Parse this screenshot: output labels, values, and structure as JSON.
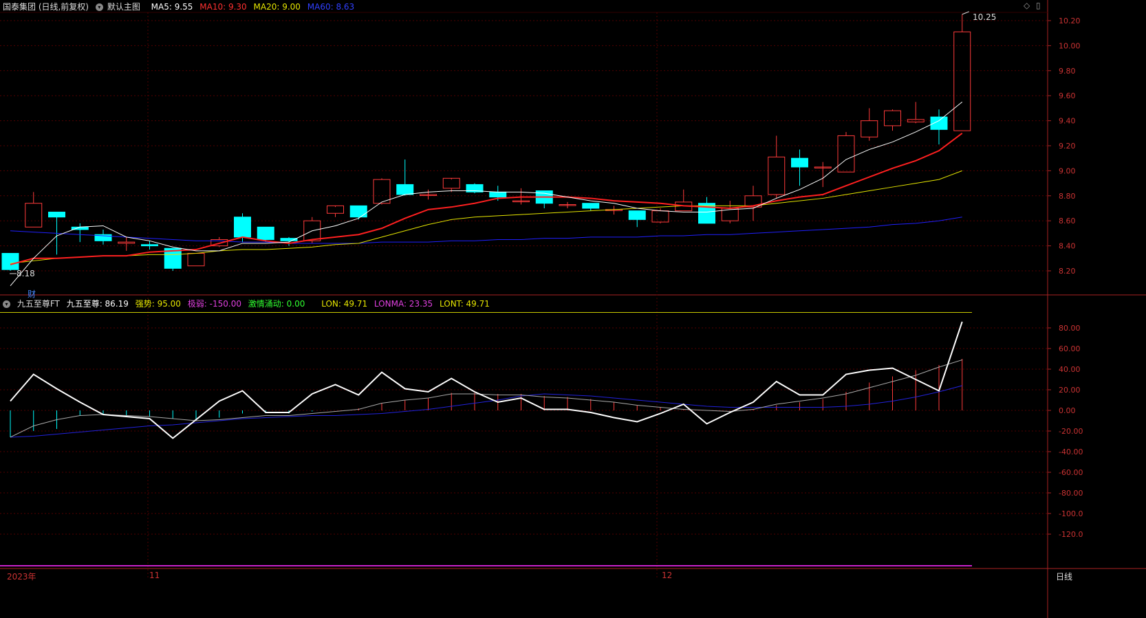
{
  "header": {
    "stock_name": "国泰集团 (日线,前复权)",
    "template_name": "默认主图",
    "ma5": "MA5: 9.55",
    "ma10": "MA10: 9.30",
    "ma20": "MA20: 9.00",
    "ma60": "MA60: 8.63"
  },
  "indicator_header": {
    "name": "九五至尊FT",
    "main": "九五至尊: 86.19",
    "strong": "强势: 95.00",
    "weak": "极弱: -150.00",
    "passion": "激情涌动: 0.00",
    "lon": "LON: 49.71",
    "lonma": "LONMA: 23.35",
    "lont": "LONT: 49.71"
  },
  "bottom": {
    "year_label": "2023年",
    "month_11": "11",
    "month_12": "12",
    "period_label": "日线"
  },
  "annotations": {
    "max_label": "10.25",
    "min_label": "8.18",
    "finance_marker": "财"
  },
  "colors": {
    "up": "#ff3b3b",
    "down": "#00ffff",
    "ma5": "#ffffff",
    "ma10": "#ff2020",
    "ma20": "#e6e600",
    "ma60": "#2020ff",
    "grid": "#550000",
    "lonma": "#aaaaaa",
    "lont": "#2222dd",
    "strong_line": "#cccc00",
    "weak_line": "#cc22cc"
  },
  "chart_data": [
    {
      "type": "candlestick",
      "ylim": [
        8.1,
        10.3
      ],
      "yticks": [
        "10.20",
        "10.00",
        "9.80",
        "9.60",
        "9.40",
        "9.20",
        "9.00",
        "8.80",
        "8.60",
        "8.40",
        "8.20"
      ],
      "ohlc": [
        [
          8.34,
          8.34,
          8.2,
          8.21
        ],
        [
          8.55,
          8.83,
          8.55,
          8.74
        ],
        [
          8.67,
          8.67,
          8.33,
          8.63
        ],
        [
          8.55,
          8.58,
          8.43,
          8.53
        ],
        [
          8.49,
          8.53,
          8.41,
          8.44
        ],
        [
          8.42,
          8.47,
          8.36,
          8.43
        ],
        [
          8.41,
          8.44,
          8.37,
          8.4
        ],
        [
          8.38,
          8.38,
          8.2,
          8.22
        ],
        [
          8.24,
          8.34,
          8.24,
          8.34
        ],
        [
          8.4,
          8.47,
          8.39,
          8.45
        ],
        [
          8.63,
          8.66,
          8.43,
          8.47
        ],
        [
          8.55,
          8.55,
          8.43,
          8.45
        ],
        [
          8.46,
          8.47,
          8.4,
          8.44
        ],
        [
          8.44,
          8.63,
          8.42,
          8.6
        ],
        [
          8.66,
          8.71,
          8.63,
          8.72
        ],
        [
          8.72,
          8.72,
          8.61,
          8.63
        ],
        [
          8.74,
          8.94,
          8.73,
          8.93
        ],
        [
          8.89,
          9.09,
          8.8,
          8.81
        ],
        [
          8.81,
          8.85,
          8.77,
          8.81
        ],
        [
          8.86,
          8.93,
          8.83,
          8.94
        ],
        [
          8.89,
          8.9,
          8.82,
          8.83
        ],
        [
          8.83,
          8.88,
          8.76,
          8.79
        ],
        [
          8.76,
          8.86,
          8.73,
          8.76
        ],
        [
          8.84,
          8.84,
          8.7,
          8.74
        ],
        [
          8.73,
          8.75,
          8.7,
          8.73
        ],
        [
          8.74,
          8.74,
          8.68,
          8.7
        ],
        [
          8.69,
          8.72,
          8.65,
          8.69
        ],
        [
          8.68,
          8.68,
          8.55,
          8.61
        ],
        [
          8.59,
          8.7,
          8.58,
          8.68
        ],
        [
          8.68,
          8.85,
          8.68,
          8.75
        ],
        [
          8.74,
          8.79,
          8.58,
          8.58
        ],
        [
          8.6,
          8.76,
          8.58,
          8.7
        ],
        [
          8.71,
          8.88,
          8.6,
          8.8
        ],
        [
          8.81,
          9.28,
          8.78,
          9.11
        ],
        [
          9.1,
          9.17,
          8.88,
          9.03
        ],
        [
          9.03,
          9.07,
          8.87,
          9.03
        ],
        [
          8.99,
          9.31,
          8.99,
          9.28
        ],
        [
          9.27,
          9.5,
          9.24,
          9.4
        ],
        [
          9.36,
          9.49,
          9.32,
          9.48
        ],
        [
          9.39,
          9.55,
          9.38,
          9.41
        ],
        [
          9.43,
          9.49,
          9.21,
          9.33
        ],
        [
          9.32,
          10.25,
          9.32,
          10.11
        ]
      ],
      "ma5": [
        8.08,
        8.3,
        8.48,
        8.55,
        8.56,
        8.47,
        8.44,
        8.39,
        8.36,
        8.36,
        8.42,
        8.42,
        8.43,
        8.52,
        8.56,
        8.62,
        8.75,
        8.81,
        8.83,
        8.84,
        8.84,
        8.83,
        8.83,
        8.82,
        8.79,
        8.76,
        8.74,
        8.7,
        8.68,
        8.67,
        8.67,
        8.69,
        8.7,
        8.78,
        8.85,
        8.94,
        9.09,
        9.17,
        9.23,
        9.31,
        9.4,
        9.55
      ],
      "ma10": [
        8.25,
        8.3,
        8.3,
        8.31,
        8.32,
        8.32,
        8.35,
        8.36,
        8.37,
        8.42,
        8.47,
        8.44,
        8.42,
        8.45,
        8.47,
        8.49,
        8.54,
        8.62,
        8.69,
        8.71,
        8.74,
        8.78,
        8.79,
        8.79,
        8.79,
        8.78,
        8.76,
        8.75,
        8.74,
        8.72,
        8.71,
        8.7,
        8.72,
        8.76,
        8.79,
        8.81,
        8.88,
        8.95,
        9.02,
        9.08,
        9.16,
        9.3
      ],
      "ma20": [
        8.26,
        8.28,
        8.3,
        8.31,
        8.32,
        8.32,
        8.33,
        8.33,
        8.34,
        8.36,
        8.37,
        8.37,
        8.38,
        8.39,
        8.41,
        8.42,
        8.47,
        8.52,
        8.57,
        8.61,
        8.63,
        8.64,
        8.65,
        8.66,
        8.67,
        8.68,
        8.69,
        8.7,
        8.71,
        8.72,
        8.72,
        8.72,
        8.72,
        8.74,
        8.76,
        8.78,
        8.81,
        8.84,
        8.87,
        8.9,
        8.93,
        9.0
      ],
      "ma60": [
        8.52,
        8.51,
        8.5,
        8.49,
        8.48,
        8.47,
        8.46,
        8.45,
        8.44,
        8.44,
        8.43,
        8.43,
        8.42,
        8.42,
        8.42,
        8.42,
        8.43,
        8.43,
        8.43,
        8.44,
        8.44,
        8.45,
        8.45,
        8.46,
        8.46,
        8.47,
        8.47,
        8.47,
        8.48,
        8.48,
        8.49,
        8.49,
        8.5,
        8.51,
        8.52,
        8.53,
        8.54,
        8.55,
        8.57,
        8.58,
        8.6,
        8.63
      ]
    },
    {
      "type": "line",
      "title": "九五至尊FT",
      "ylim": [
        -150,
        95
      ],
      "yticks": [
        "80.00",
        "60.00",
        "40.00",
        "20.00",
        "0.00",
        "-20.00",
        "-40.00",
        "-60.00",
        "-80.00",
        "-100.0",
        "-120.0"
      ],
      "strong": 95,
      "weak": -150,
      "series": [
        {
          "name": "九五至尊",
          "values": [
            9,
            35,
            21,
            8,
            -4,
            -6,
            -8,
            -27,
            -9,
            9,
            19,
            -2,
            -2,
            16,
            25,
            15,
            37,
            21,
            18,
            31,
            18,
            8,
            12,
            1,
            1,
            -2,
            -7,
            -11,
            -3,
            6,
            -13,
            -2,
            8,
            28,
            15,
            15,
            35,
            39,
            41,
            30,
            19,
            86
          ]
        },
        {
          "name": "LONMA",
          "values": [
            -26,
            -15,
            -9,
            -5,
            -4,
            -5,
            -6,
            -8,
            -10,
            -9,
            -7,
            -5,
            -5,
            -3,
            -1,
            1,
            7,
            10,
            12,
            16,
            16,
            15,
            15,
            13,
            12,
            10,
            8,
            5,
            3,
            1,
            0,
            -1,
            1,
            6,
            9,
            12,
            16,
            22,
            28,
            34,
            42,
            49
          ]
        },
        {
          "name": "LONT",
          "values": [
            -26,
            -25,
            -23,
            -21,
            -19,
            -17,
            -15,
            -14,
            -12,
            -10,
            -8,
            -7,
            -6,
            -5,
            -5,
            -4,
            -3,
            -1,
            1,
            4,
            7,
            10,
            14,
            16,
            15,
            14,
            12,
            10,
            8,
            6,
            4,
            3,
            3,
            3,
            3,
            3,
            4,
            6,
            9,
            13,
            18,
            24
          ]
        },
        {
          "name": "LON",
          "values": [
            -26,
            -20,
            -18,
            -5,
            -4,
            -5,
            -6,
            -8,
            -10,
            -7,
            -3,
            -2,
            -3,
            -1,
            0,
            2,
            7,
            10,
            12,
            17,
            17,
            16,
            16,
            14,
            13,
            11,
            8,
            5,
            3,
            1,
            0,
            0,
            1,
            5,
            8,
            11,
            18,
            27,
            33,
            39,
            44,
            50
          ]
        }
      ]
    }
  ]
}
